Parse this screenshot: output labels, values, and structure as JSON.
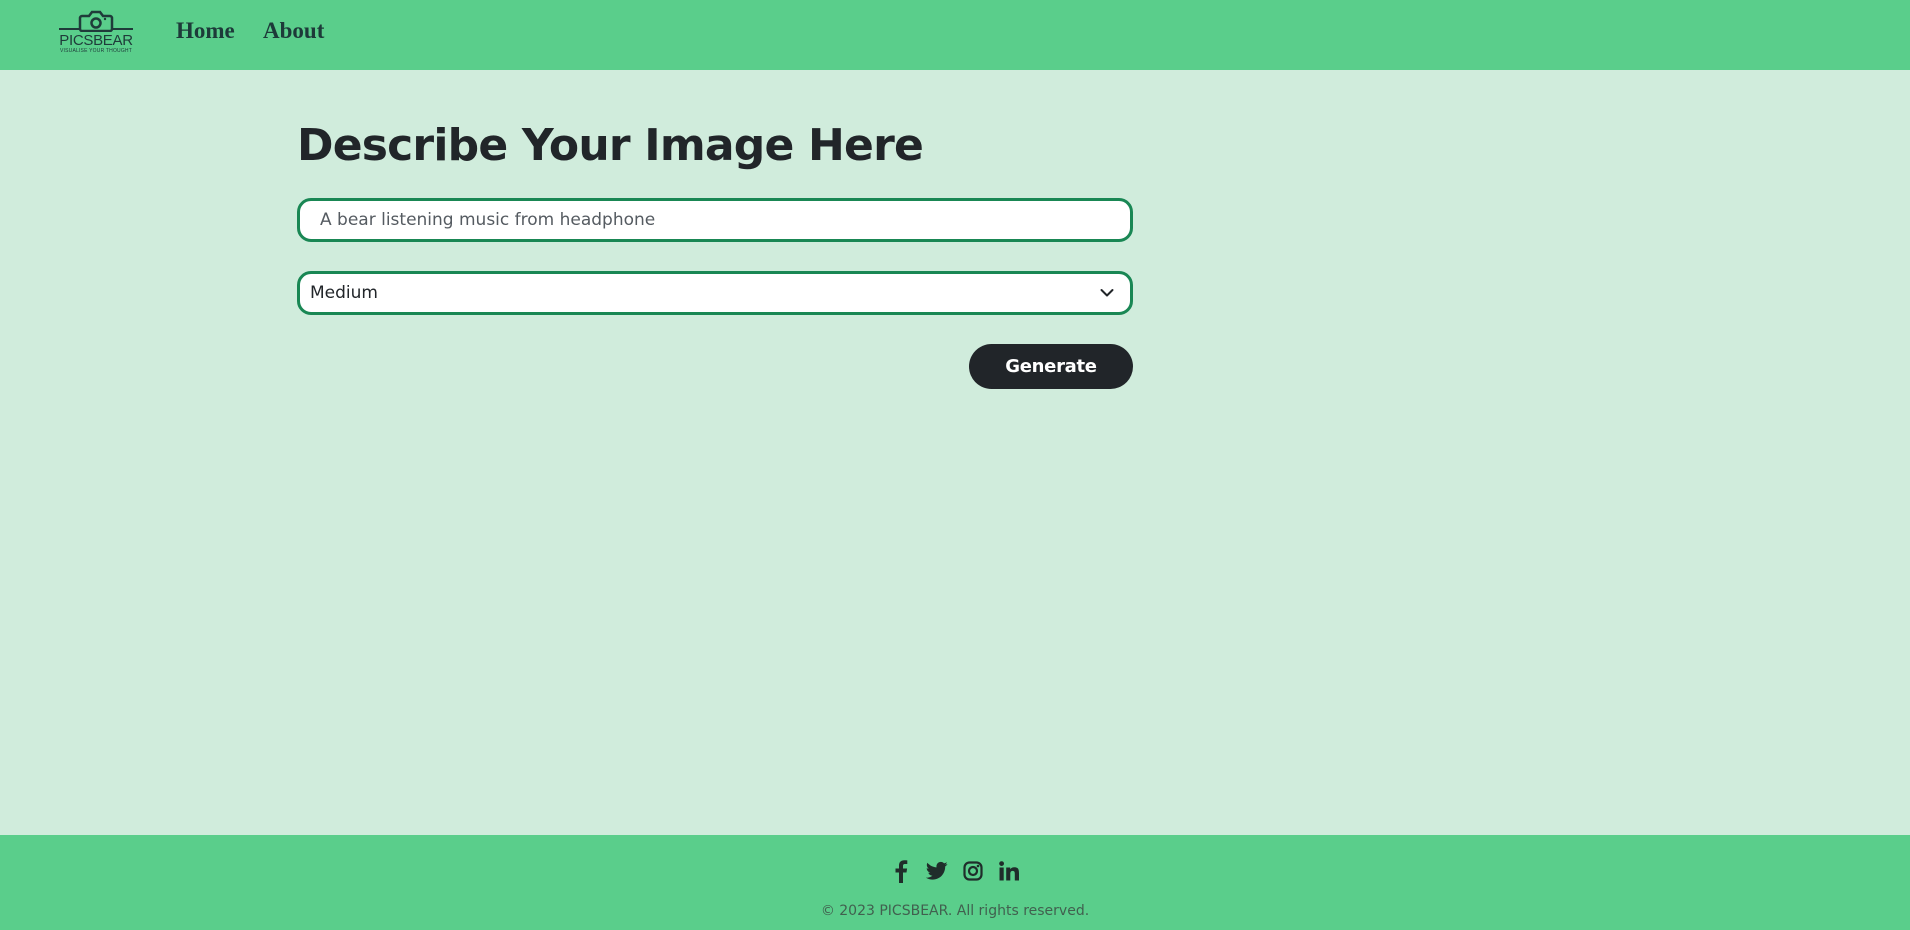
{
  "navbar": {
    "logo": {
      "name": "PICSBEAR",
      "tagline": "VISUALISE YOUR THOUGHT",
      "icon": "camera-icon"
    },
    "links": [
      {
        "label": "Home"
      },
      {
        "label": "About"
      }
    ]
  },
  "main": {
    "heading": "Describe Your Image Here",
    "prompt_input": {
      "value": "A bear listening music from headphone",
      "placeholder": ""
    },
    "size_select": {
      "selected": "Medium",
      "icon": "chevron-down-icon"
    },
    "generate_label": "Generate"
  },
  "footer": {
    "social_icons": [
      "facebook-icon",
      "twitter-icon",
      "instagram-icon",
      "linkedin-icon"
    ],
    "copyright": "© 2023 PICSBEAR. All rights reserved."
  },
  "colors": {
    "navbar_bg": "#5ace8b",
    "page_bg": "#d0ecdc",
    "input_border": "#198754",
    "button_bg": "#212529",
    "text_dark": "#212529"
  }
}
